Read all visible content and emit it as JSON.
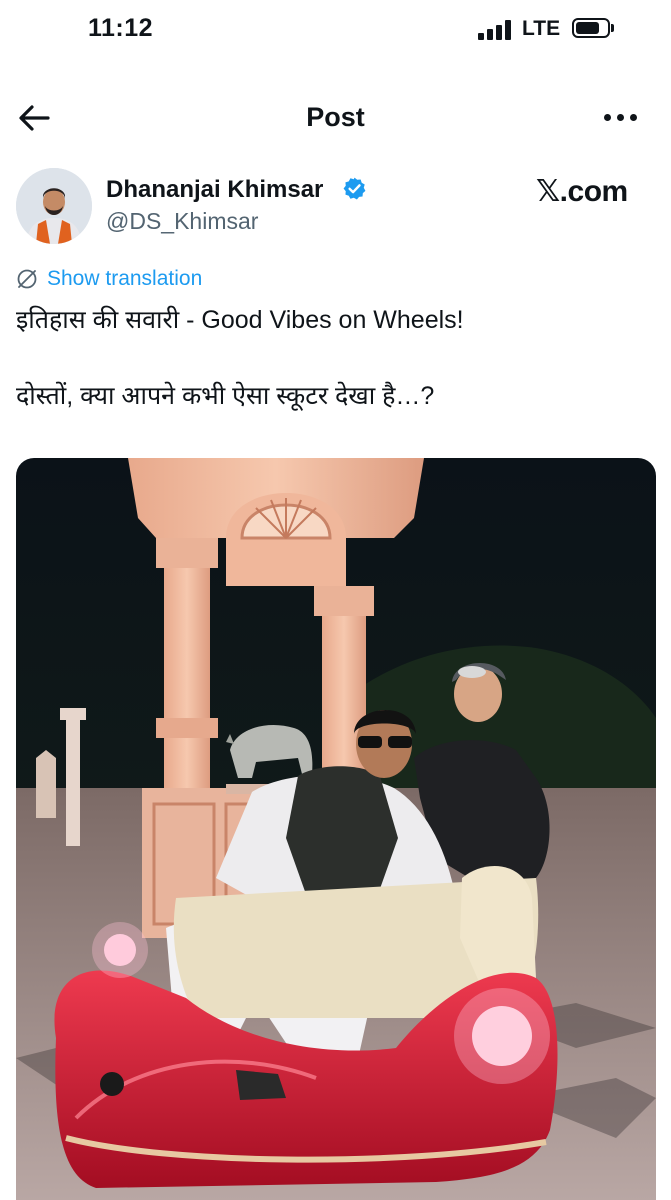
{
  "status_bar": {
    "time": "11:12",
    "network": "LTE",
    "battery_level": 0.75
  },
  "nav": {
    "title": "Post",
    "back_icon": "arrow-left-icon",
    "more_icon": "more-horizontal-icon"
  },
  "post": {
    "author_name": "Dhananjai Khimsar",
    "author_handle": "@DS_Khimsar",
    "verified": true,
    "site_label": "𝕏.com",
    "translate_label": "Show translation",
    "text_line_1": "इतिहास की सवारी - Good Vibes on Wheels!",
    "text_line_2": "दोस्तों, क्या आपने कभी ऐसा स्कूटर देखा है…?"
  },
  "colors": {
    "text_primary": "#0f1419",
    "text_secondary": "#536471",
    "link": "#1d9bf0",
    "verified_badge": "#1d9bf0"
  }
}
